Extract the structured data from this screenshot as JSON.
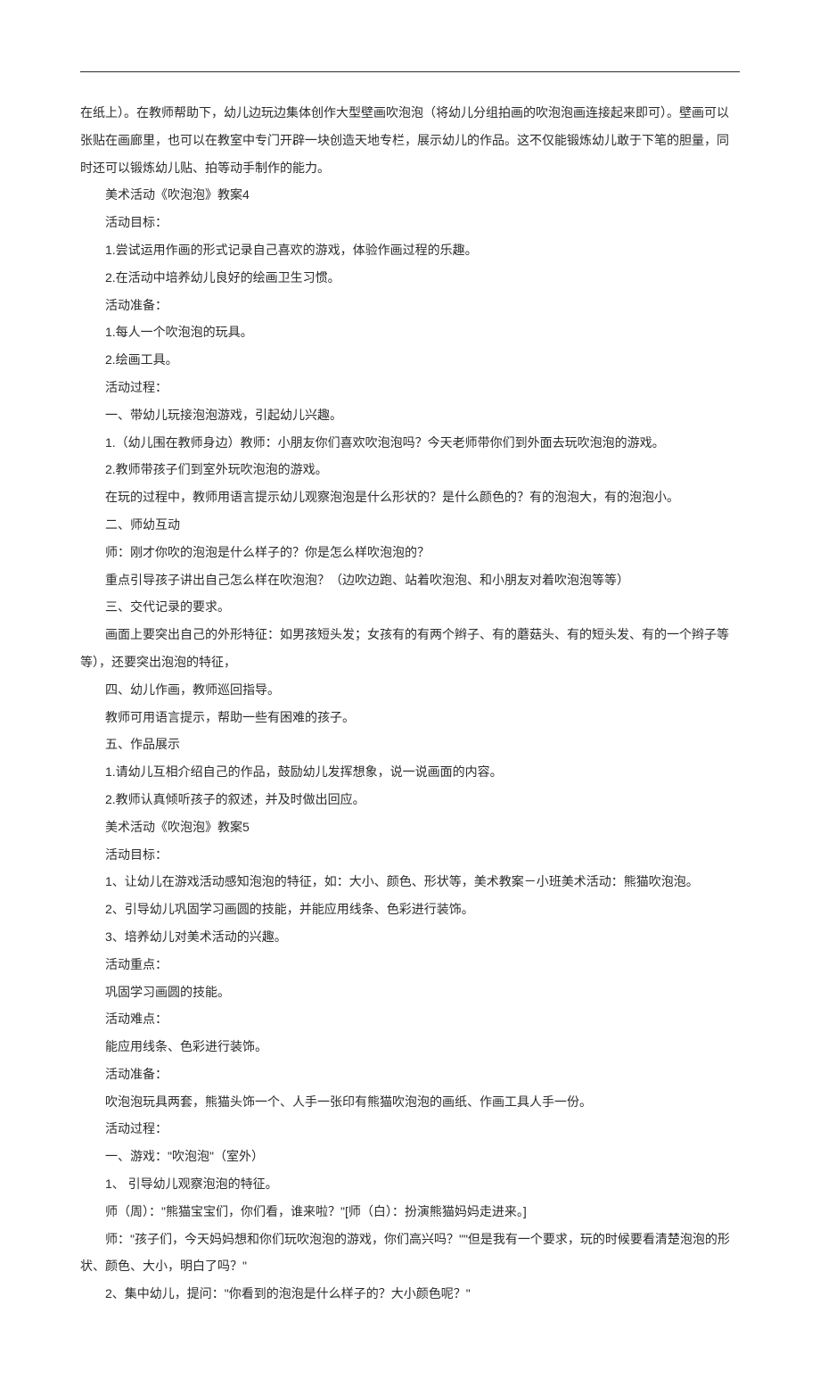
{
  "lines": [
    {
      "indent": false,
      "text": "在纸上）。在教师帮助下，幼儿边玩边集体创作大型壁画吹泡泡（将幼儿分组拍画的吹泡泡画连接起来即可）。壁画可以张贴在画廊里，也可以在教室中专门开辟一块创造天地专栏，展示幼儿的作品。这不仅能锻炼幼儿敢于下笔的胆量，同时还可以锻炼幼儿贴、拍等动手制作的能力。"
    },
    {
      "indent": true,
      "text": "美术活动《吹泡泡》教案4"
    },
    {
      "indent": true,
      "text": "活动目标："
    },
    {
      "indent": true,
      "text": "1.尝试运用作画的形式记录自己喜欢的游戏，体验作画过程的乐趣。"
    },
    {
      "indent": true,
      "text": "2.在活动中培养幼儿良好的绘画卫生习惯。"
    },
    {
      "indent": true,
      "text": "活动准备："
    },
    {
      "indent": true,
      "text": "1.每人一个吹泡泡的玩具。"
    },
    {
      "indent": true,
      "text": "2.绘画工具。"
    },
    {
      "indent": true,
      "text": "活动过程："
    },
    {
      "indent": true,
      "text": "一、带幼儿玩接泡泡游戏，引起幼儿兴趣。"
    },
    {
      "indent": true,
      "text": "1.（幼儿围在教师身边）教师：小朋友你们喜欢吹泡泡吗？今天老师带你们到外面去玩吹泡泡的游戏。"
    },
    {
      "indent": true,
      "text": "2.教师带孩子们到室外玩吹泡泡的游戏。"
    },
    {
      "indent": true,
      "text": "在玩的过程中，教师用语言提示幼儿观察泡泡是什么形状的？是什么颜色的？有的泡泡大，有的泡泡小。"
    },
    {
      "indent": true,
      "text": "二、师幼互动"
    },
    {
      "indent": true,
      "text": "师：刚才你吹的泡泡是什么样子的？你是怎么样吹泡泡的？"
    },
    {
      "indent": true,
      "text": "重点引导孩子讲出自己怎么样在吹泡泡？（边吹边跑、站着吹泡泡、和小朋友对着吹泡泡等等）"
    },
    {
      "indent": true,
      "text": "三、交代记录的要求。"
    },
    {
      "indent": true,
      "text": "画面上要突出自己的外形特征：如男孩短头发；女孩有的有两个辫子、有的蘑菇头、有的短头发、有的一个辫子等"
    },
    {
      "indent": false,
      "text": "等），还要突出泡泡的特征，"
    },
    {
      "indent": true,
      "text": "四、幼儿作画，教师巡回指导。"
    },
    {
      "indent": true,
      "text": "教师可用语言提示，帮助一些有困难的孩子。"
    },
    {
      "indent": true,
      "text": "五、作品展示"
    },
    {
      "indent": true,
      "text": "1.请幼儿互相介绍自己的作品，鼓励幼儿发挥想象，说一说画面的内容。"
    },
    {
      "indent": true,
      "text": "2.教师认真倾听孩子的叙述，并及时做出回应。"
    },
    {
      "indent": true,
      "text": "美术活动《吹泡泡》教案5"
    },
    {
      "indent": true,
      "text": "活动目标："
    },
    {
      "indent": true,
      "text": "1、让幼儿在游戏活动感知泡泡的特征，如：大小、颜色、形状等，美术教案－小班美术活动：熊猫吹泡泡。"
    },
    {
      "indent": true,
      "text": "2、引导幼儿巩固学习画圆的技能，并能应用线条、色彩进行装饰。"
    },
    {
      "indent": true,
      "text": "3、培养幼儿对美术活动的兴趣。"
    },
    {
      "indent": true,
      "text": "活动重点："
    },
    {
      "indent": true,
      "text": "巩固学习画圆的技能。"
    },
    {
      "indent": true,
      "text": "活动难点："
    },
    {
      "indent": true,
      "text": "能应用线条、色彩进行装饰。"
    },
    {
      "indent": true,
      "text": "活动准备："
    },
    {
      "indent": true,
      "text": "吹泡泡玩具两套，熊猫头饰一个、人手一张印有熊猫吹泡泡的画纸、作画工具人手一份。"
    },
    {
      "indent": true,
      "text": "活动过程："
    },
    {
      "indent": true,
      "text": "一、游戏：\"吹泡泡\"（室外）"
    },
    {
      "indent": true,
      "text": "1、 引导幼儿观察泡泡的特征。"
    },
    {
      "indent": true,
      "text": "师（周）：\"熊猫宝宝们，你们看，谁来啦？\"[师（白）：扮演熊猫妈妈走进来。]"
    },
    {
      "indent": true,
      "text": "师：\"孩子们，今天妈妈想和你们玩吹泡泡的游戏，你们高兴吗？\"\"但是我有一个要求，玩的时候要看清楚泡泡的形"
    },
    {
      "indent": false,
      "text": "状、颜色、大小，明白了吗？\""
    },
    {
      "indent": true,
      "text": "2、集中幼儿，提问：\"你看到的泡泡是什么样子的？大小颜色呢？\""
    }
  ]
}
